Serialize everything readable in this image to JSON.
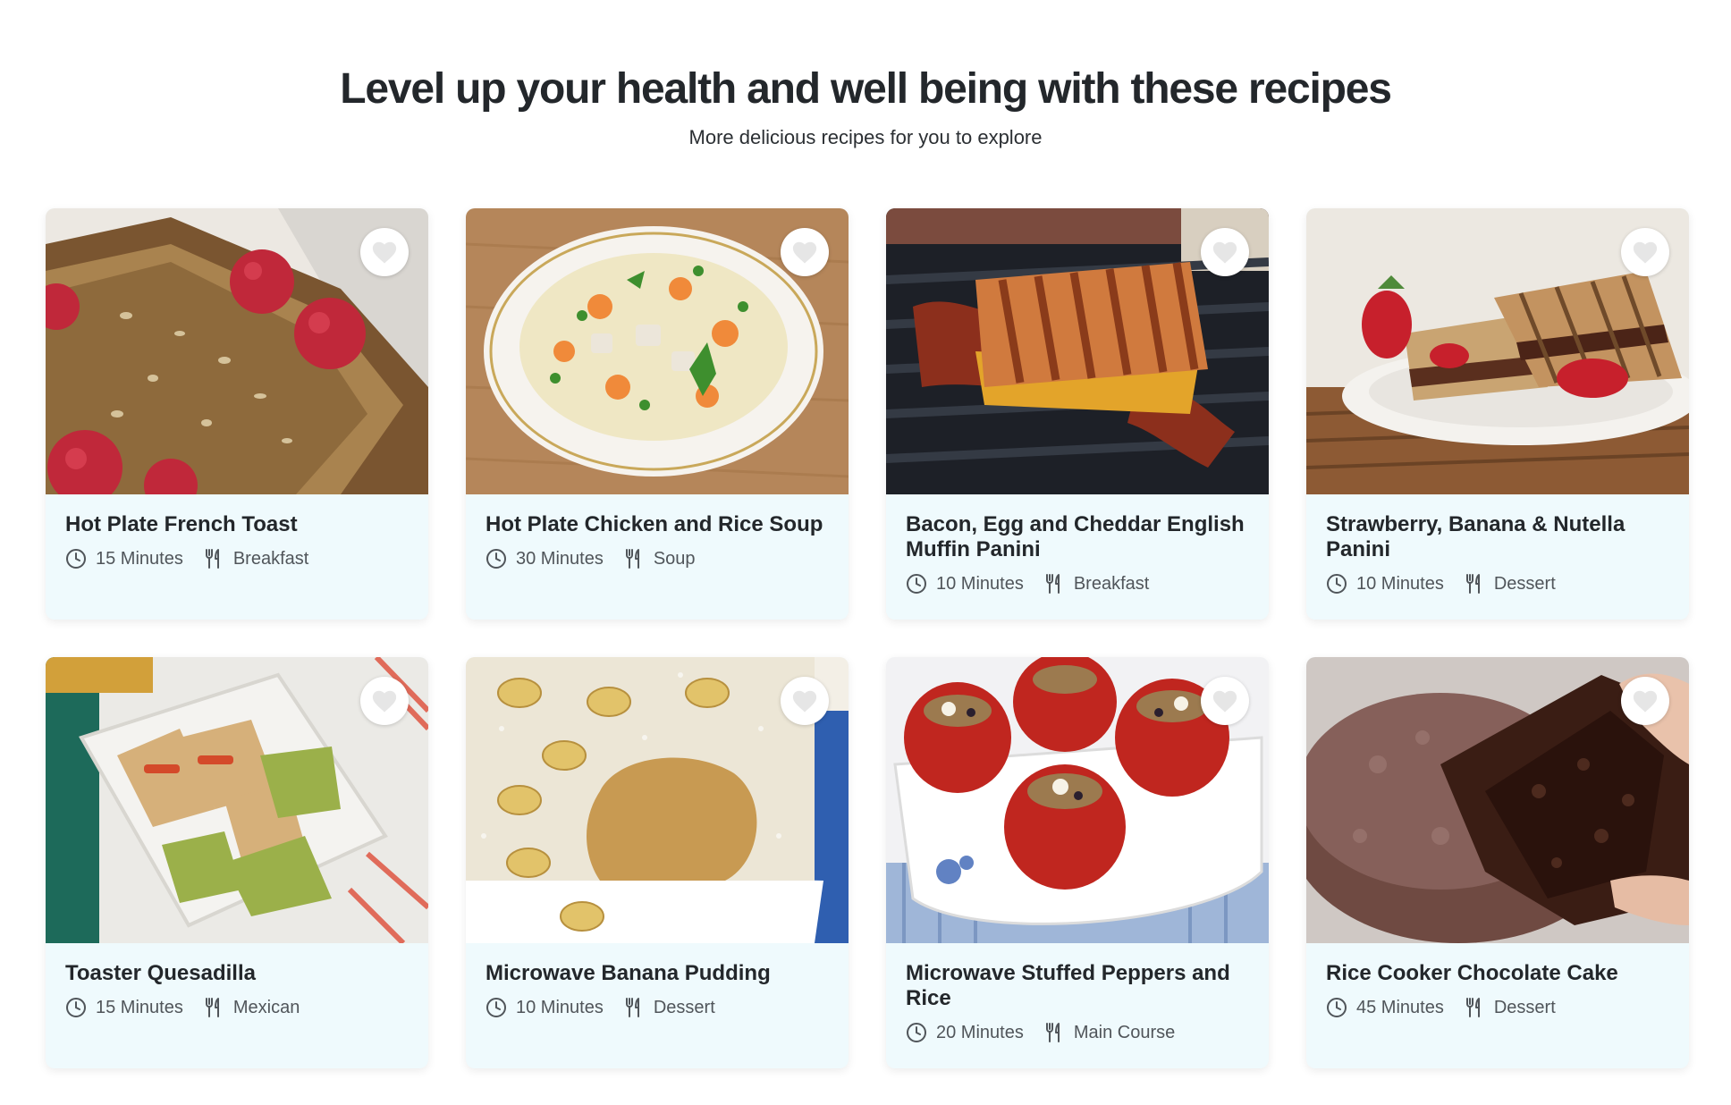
{
  "header": {
    "title": "Level up your health and well being with these recipes",
    "subtitle": "More delicious recipes for you to explore"
  },
  "recipes": [
    {
      "title": "Hot Plate French Toast",
      "time": "15 Minutes",
      "category": "Breakfast",
      "image": "french-toast-photo"
    },
    {
      "title": "Hot Plate Chicken and Rice Soup",
      "time": "30 Minutes",
      "category": "Soup",
      "image": "chicken-soup-photo"
    },
    {
      "title": "Bacon, Egg and Cheddar English Muffin Panini",
      "time": "10 Minutes",
      "category": "Breakfast",
      "image": "bacon-panini-photo"
    },
    {
      "title": "Strawberry, Banana & Nutella Panini",
      "time": "10 Minutes",
      "category": "Dessert",
      "image": "nutella-panini-photo"
    },
    {
      "title": "Toaster Quesadilla",
      "time": "15 Minutes",
      "category": "Mexican",
      "image": "quesadilla-photo"
    },
    {
      "title": "Microwave Banana Pudding",
      "time": "10 Minutes",
      "category": "Dessert",
      "image": "banana-pudding-photo"
    },
    {
      "title": "Microwave Stuffed Peppers and Rice",
      "time": "20 Minutes",
      "category": "Main Course",
      "image": "stuffed-peppers-photo"
    },
    {
      "title": "Rice Cooker Chocolate Cake",
      "time": "45 Minutes",
      "category": "Dessert",
      "image": "chocolate-cake-photo"
    }
  ],
  "icons": {
    "favorite": "heart-icon",
    "time": "clock-icon",
    "category": "fork-knife-icon"
  },
  "colors": {
    "card_background": "#effafd",
    "heart": "#e6e6e6",
    "text_dark": "#23272b",
    "meta_text": "#50555a"
  }
}
